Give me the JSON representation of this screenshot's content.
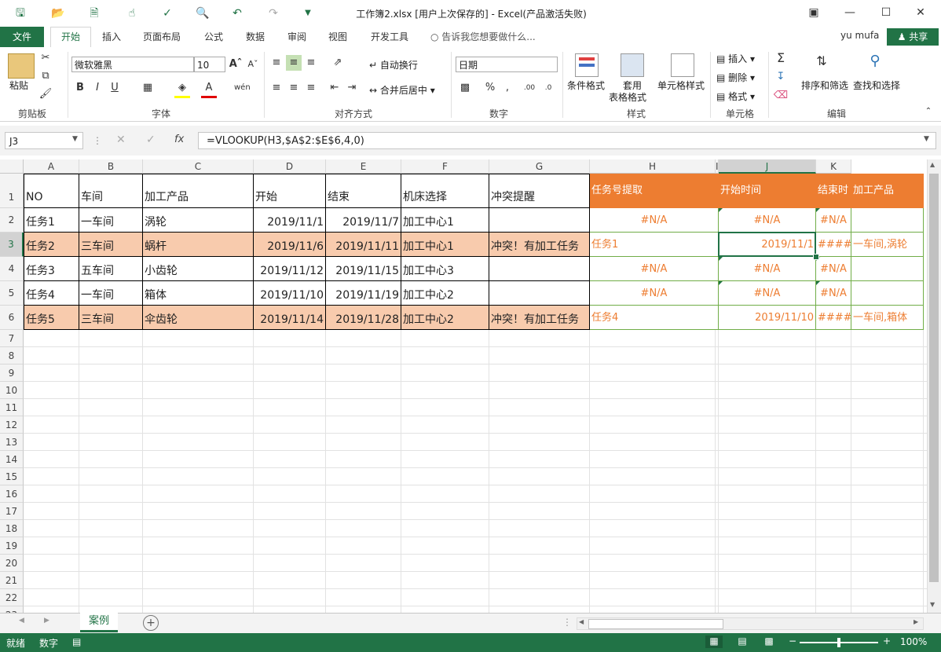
{
  "window": {
    "title": "工作簿2.xlsx [用户上次保存的] - Excel(产品激活失败)"
  },
  "tabs": [
    "文件",
    "开始",
    "插入",
    "页面布局",
    "公式",
    "数据",
    "审阅",
    "视图",
    "开发工具"
  ],
  "tell_me": "告诉我您想要做什么...",
  "user": "yu mufa",
  "share": "共享",
  "ribbon": {
    "paste": "粘贴",
    "clipboard": "剪贴板",
    "font_name": "微软雅黑",
    "font_size": "10",
    "font_group": "字体",
    "wrap_text": "自动换行",
    "merge_center": "合并后居中",
    "align_group": "对齐方式",
    "number_format": "日期",
    "number_group": "数字",
    "cond_format": "条件格式",
    "table_format_1": "套用",
    "table_format_2": "表格格式",
    "cell_styles": "单元格样式",
    "styles_group": "样式",
    "insert": "插入",
    "delete": "删除",
    "format": "格式",
    "cells_group": "单元格",
    "sort_filter": "排序和筛选",
    "find_select": "查找和选择",
    "edit_group": "编辑"
  },
  "formula_bar": {
    "name_box": "J3",
    "formula": "=VLOOKUP(H3,$A$2:$E$6,4,0)"
  },
  "columns": [
    "A",
    "B",
    "C",
    "D",
    "E",
    "F",
    "G",
    "H",
    "I",
    "J",
    "K"
  ],
  "rows": [
    "1",
    "2",
    "3",
    "4",
    "5",
    "6",
    "7",
    "8",
    "9",
    "10",
    "11",
    "12",
    "13",
    "14",
    "15",
    "16",
    "17",
    "18",
    "19",
    "20",
    "21",
    "22",
    "23"
  ],
  "table": {
    "headers": [
      "NO",
      "车间",
      "加工产品",
      "开始",
      "结束",
      "机床选择",
      "冲突提醒"
    ],
    "rows": [
      [
        "任务1",
        "一车间",
        "涡轮",
        "2019/11/1",
        "2019/11/7",
        "加工中心1",
        ""
      ],
      [
        "任务2",
        "三车间",
        "蜗杆",
        "2019/11/6",
        "2019/11/11",
        "加工中心1",
        "冲突！有加工任务"
      ],
      [
        "任务3",
        "五车间",
        "小齿轮",
        "2019/11/12",
        "2019/11/15",
        "加工中心3",
        ""
      ],
      [
        "任务4",
        "一车间",
        "箱体",
        "2019/11/10",
        "2019/11/19",
        "加工中心2",
        ""
      ],
      [
        "任务5",
        "三车间",
        "伞齿轮",
        "2019/11/14",
        "2019/11/28",
        "加工中心2",
        "冲突！有加工任务"
      ]
    ]
  },
  "lookup": {
    "headers": [
      "任务号提取",
      "开始时间",
      "结束时",
      "加工产品"
    ],
    "rows": [
      [
        "#N/A",
        "#N/A",
        "#N/A",
        ""
      ],
      [
        "任务1",
        "2019/11/1",
        "#####",
        "一车间,涡轮"
      ],
      [
        "#N/A",
        "#N/A",
        "#N/A",
        ""
      ],
      [
        "#N/A",
        "#N/A",
        "#N/A",
        ""
      ],
      [
        "任务4",
        "2019/11/10",
        "#####",
        "一车间,箱体"
      ]
    ]
  },
  "sheet_tab": "案例",
  "status": {
    "ready": "就绪",
    "mode": "数字",
    "zoom": "100%"
  },
  "colors": {
    "excel_green": "#217346",
    "orange": "#ed7d31",
    "pink": "#f8cbad"
  }
}
